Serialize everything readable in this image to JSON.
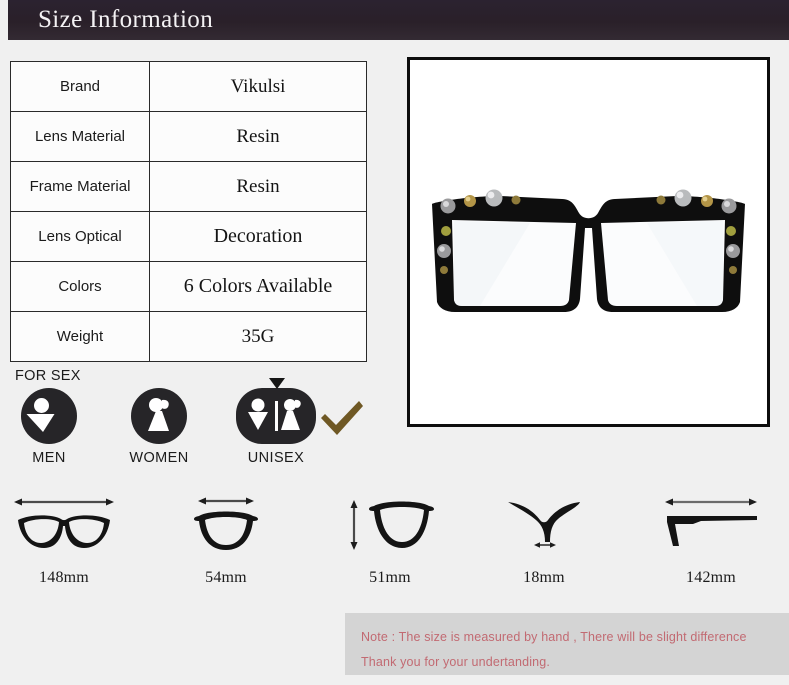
{
  "header": {
    "title": "Size Information",
    "bg_color": "#2a2029",
    "text_color": "#f4f2f4"
  },
  "spec_table": {
    "rows": [
      {
        "label": "Brand",
        "value": "Vikulsi"
      },
      {
        "label": "Lens Material",
        "value": "Resin"
      },
      {
        "label": "Frame Material",
        "value": "Resin"
      },
      {
        "label": "Lens Optical",
        "value": "Decoration"
      },
      {
        "label": "Colors",
        "value": "6 Colors Available"
      },
      {
        "label": "Weight",
        "value": "35G"
      }
    ]
  },
  "product_image": {
    "alt": "black oversized square eyeglasses with metal studs",
    "background": "#ffffff",
    "border_color": "#0d0d0d"
  },
  "for_sex": {
    "label": "FOR SEX",
    "selected": "UNISEX",
    "check_color": "#6f5824",
    "icon_color": "#262528",
    "options": [
      {
        "caption": "MEN",
        "icon": "male-figure-icon"
      },
      {
        "caption": "WOMEN",
        "icon": "female-figure-icon"
      },
      {
        "caption": "UNISEX",
        "icon": "unisex-figures-icon"
      }
    ]
  },
  "measurements": [
    {
      "caption": "148mm",
      "icon": "frame-total-width-icon"
    },
    {
      "caption": "54mm",
      "icon": "lens-width-icon"
    },
    {
      "caption": "51mm",
      "icon": "lens-height-icon"
    },
    {
      "caption": "18mm",
      "icon": "bridge-width-icon"
    },
    {
      "caption": "142mm",
      "icon": "temple-length-icon"
    }
  ],
  "note": {
    "line1": "Note : The size is measured by hand , There will be slight difference",
    "line2": "Thank you for your undertanding.",
    "text_color": "#c26a72",
    "bg_color": "#d4d4d4"
  }
}
